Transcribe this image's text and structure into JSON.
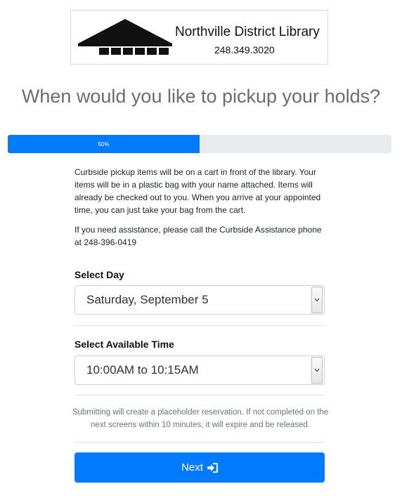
{
  "logo": {
    "name": "Northville District Library",
    "phone": "248.349.3020"
  },
  "heading": "When would you like to pickup your holds?",
  "progress": {
    "value": 0.5,
    "label": "50%"
  },
  "info": {
    "paragraph1": "Curbside pickup items will be on a cart in front of the library. Your items will be in a plastic bag with your name attached. Items will already be checked out to you. When you arrive at your appointed time, you can just take your bag from the cart.",
    "paragraph2": "If you need assistance, please call the Curbside Assistance phone at 248-396-0419"
  },
  "select_day": {
    "label": "Select Day",
    "value": "Saturday, September 5"
  },
  "select_time": {
    "label": "Select Available Time",
    "value": "10:00AM to 10:15AM"
  },
  "notice": "Submitting will create a placeholder reservation. If not completed on the next screens within 10 minutes, it will expire and be released.",
  "next_button": {
    "label": "Next",
    "icon": "sign-in-icon"
  },
  "colors": {
    "primary": "#007bff",
    "progress_track": "#e9ecef",
    "heading": "#6c6c6c"
  }
}
